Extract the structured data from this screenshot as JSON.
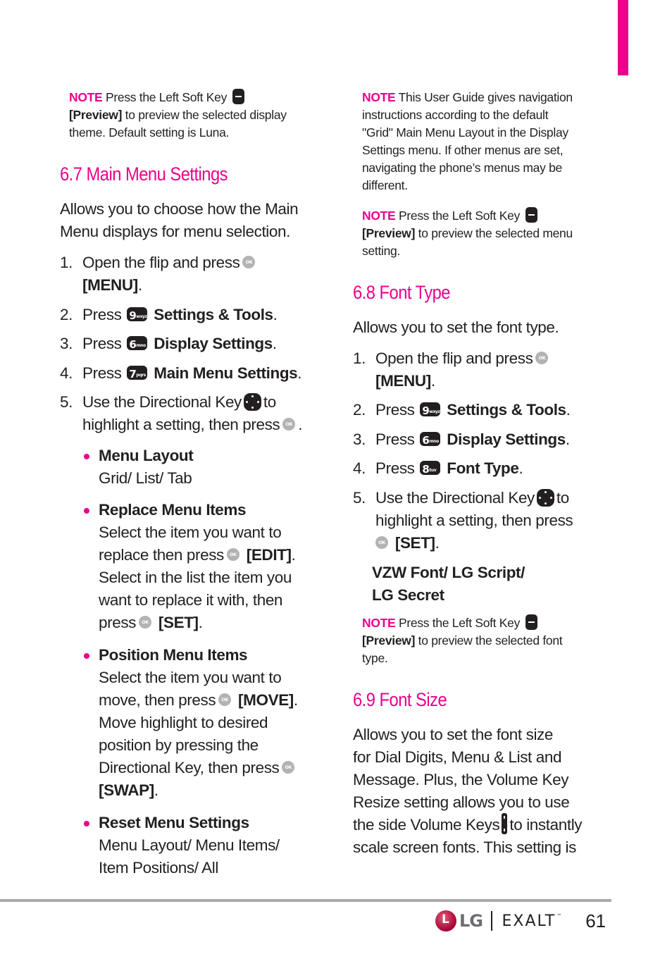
{
  "accent_color": "#ec008c",
  "left": {
    "note_top": {
      "label": "NOTE",
      "line1": " Press the Left Soft Key ",
      "preview": "[Preview]",
      "line2": " to preview the selected display",
      "line3": "theme. Default setting is Luna."
    },
    "section_67": {
      "heading": "6.7 Main Menu Settings",
      "intro_line1": "Allows you to choose how the Main",
      "intro_line2": "Menu displays for menu selection.",
      "steps": [
        {
          "num": "1.",
          "pre": "Open the flip and press",
          "key": "OK",
          "line2": "[MENU]",
          "post": "."
        },
        {
          "num": "2.",
          "pre": "Press",
          "key_digit": "9",
          "key_letters": "wxyz",
          "bold": "Settings & Tools",
          "post": "."
        },
        {
          "num": "3.",
          "pre": "Press",
          "key_digit": "6",
          "key_letters": "mno",
          "bold": "Display Settings",
          "post": "."
        },
        {
          "num": "4.",
          "pre": "Press",
          "key_digit": "7",
          "key_letters": "pqrs",
          "bold": "Main Menu Settings",
          "post": "."
        },
        {
          "num": "5.",
          "pre": "Use the Directional Key",
          "post1": "to",
          "line2": "highlight a setting, then press",
          "key": "OK",
          "post": "."
        }
      ],
      "options": [
        {
          "title": "Menu Layout",
          "lines": [
            "Grid/ List/ Tab"
          ]
        },
        {
          "title": "Replace Menu Items",
          "lines": [
            "Select the item you want to",
            "replace then press",
            "[EDIT]",
            ".",
            "Select in the list the item you",
            "want to replace it with, then",
            "press",
            "[SET]",
            "."
          ]
        },
        {
          "title": "Position Menu Items",
          "lines": [
            "Select the item you want to",
            "move, then press",
            "[MOVE]",
            ".",
            "Move highlight to desired",
            "position by pressing the",
            "Directional Key, then press",
            "[SWAP]",
            "."
          ]
        },
        {
          "title": "Reset Menu Settings",
          "lines": [
            "Menu Layout/ Menu Items/",
            "Item Positions/ All"
          ]
        }
      ]
    }
  },
  "right": {
    "note_grid": {
      "label": "NOTE",
      "lines": [
        " This User Guide gives navigation",
        "instructions according to the default",
        "\"Grid\" Main Menu Layout in the Display",
        "Settings menu. If other menus are set,",
        "navigating the phone’s menus may be",
        "different."
      ]
    },
    "note_menu": {
      "label": "NOTE",
      "line1": " Press the Left Soft Key ",
      "preview": "[Preview]",
      "line2": " to preview the selected menu",
      "line3": "setting."
    },
    "section_68": {
      "heading": "6.8 Font Type",
      "intro": "Allows you to set the font type.",
      "steps": [
        {
          "num": "1.",
          "pre": "Open the flip and press",
          "key": "OK",
          "line2": "[MENU]",
          "post": "."
        },
        {
          "num": "2.",
          "pre": "Press",
          "key_digit": "9",
          "key_letters": "wxyz",
          "bold": "Settings & Tools",
          "post": "."
        },
        {
          "num": "3.",
          "pre": "Press",
          "key_digit": "6",
          "key_letters": "mno",
          "bold": "Display Settings",
          "post": "."
        },
        {
          "num": "4.",
          "pre": "Press",
          "key_digit": "8",
          "key_letters": "tuv",
          "bold": "Font Type",
          "post": "."
        },
        {
          "num": "5.",
          "pre": "Use the Directional Key",
          "post1": "to",
          "line2": "highlight a setting, then press",
          "key": "OK",
          "line3": "[SET]",
          "post": "."
        }
      ],
      "options_line1": "VZW Font/ LG Script/",
      "options_line2": "LG Secret",
      "note": {
        "label": "NOTE",
        "line1": " Press the Left Soft Key ",
        "preview": "[Preview]",
        "line2": " to preview the selected font",
        "line3": "type."
      }
    },
    "section_69": {
      "heading": "6.9 Font Size",
      "lines": [
        "Allows you to set the font size",
        "for Dial Digits, Menu & List and",
        "Message. Plus, the Volume Key",
        "Resize setting allows you to use",
        "the side Volume Keys",
        "to instantly",
        "scale screen fonts. This setting is"
      ]
    }
  },
  "footer": {
    "brand": "LG",
    "product": "EXALT",
    "trademark": "™",
    "page_number": "61"
  }
}
